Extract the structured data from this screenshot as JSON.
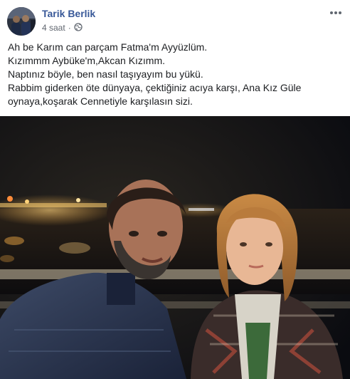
{
  "post": {
    "author_name": "Tarik Berlik",
    "timestamp": "4 saat",
    "separator": "·",
    "privacy_icon": "globe-icon",
    "more_icon": "more-horizontal-icon",
    "text_lines": [
      "Ah be Karım can parçam Fatma'm Ayyüzlüm.",
      "Kızımmm Aybüke'm,Akcan Kızımm.",
      "Naptınız böyle, ben nasıl taşıyayım bu yükü.",
      "Rabbim giderken öte dünyaya, çektiğiniz acıya karşı, Ana Kız Güle",
      "oynaya,koşarak Cennetiyle karşılasın sizi."
    ]
  },
  "colors": {
    "author_link": "#385898",
    "meta_text": "#616770",
    "body_text": "#1c1e21"
  }
}
